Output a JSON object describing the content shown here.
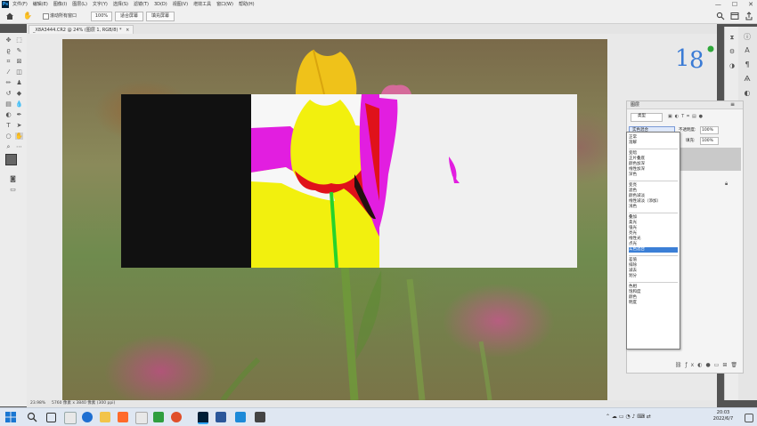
{
  "app": {
    "logo_text": "Ps"
  },
  "menu": [
    "文件(F)",
    "编辑(E)",
    "图像(I)",
    "图层(L)",
    "文字(Y)",
    "选择(S)",
    "滤镜(T)",
    "3D(D)",
    "视图(V)",
    "增效工具",
    "窗口(W)",
    "帮助(H)"
  ],
  "window_controls": {
    "minimize": "—",
    "maximize": "☐",
    "close": "✕"
  },
  "options_bar": {
    "scroll_all_label": "滚动所有窗口",
    "zoom_value": "100%",
    "fit_screen": "适合屏幕",
    "fill_screen": "填充屏幕"
  },
  "document_tab": {
    "title": "_X8A3444.CR2 @ 24% (图层 1, RGB/8) *",
    "close": "×"
  },
  "status_bar": {
    "zoom": "23.98%",
    "doc_info": "5760 像素 x 3840 像素 (300 ppi)"
  },
  "layers_panel": {
    "title": "图层",
    "filter_label": "类型",
    "blend_mode_selected": "实色混合",
    "opacity_label": "不透明度:",
    "opacity_value": "100%",
    "fill_label": "填充:",
    "fill_value": "100%",
    "blend_groups": [
      [
        "正常",
        "溶解"
      ],
      [
        "变暗",
        "正片叠底",
        "颜色加深",
        "线性加深",
        "深色"
      ],
      [
        "变亮",
        "滤色",
        "颜色减淡",
        "线性减淡（添加）",
        "浅色"
      ],
      [
        "叠加",
        "柔光",
        "强光",
        "亮光",
        "线性光",
        "点光",
        "实色混合"
      ],
      [
        "差值",
        "排除",
        "减去",
        "划分"
      ],
      [
        "色相",
        "饱和度",
        "颜色",
        "明度"
      ]
    ]
  },
  "taskbar": {
    "time": "20:03",
    "date": "2022/6/7"
  },
  "colors": {
    "blend_black": "#111111",
    "blend_white": "#f0f0f0",
    "magenta": "#e21ee0",
    "yellow": "#f2f00e",
    "red": "#e0121a",
    "highlight": "#3b7fd6"
  }
}
